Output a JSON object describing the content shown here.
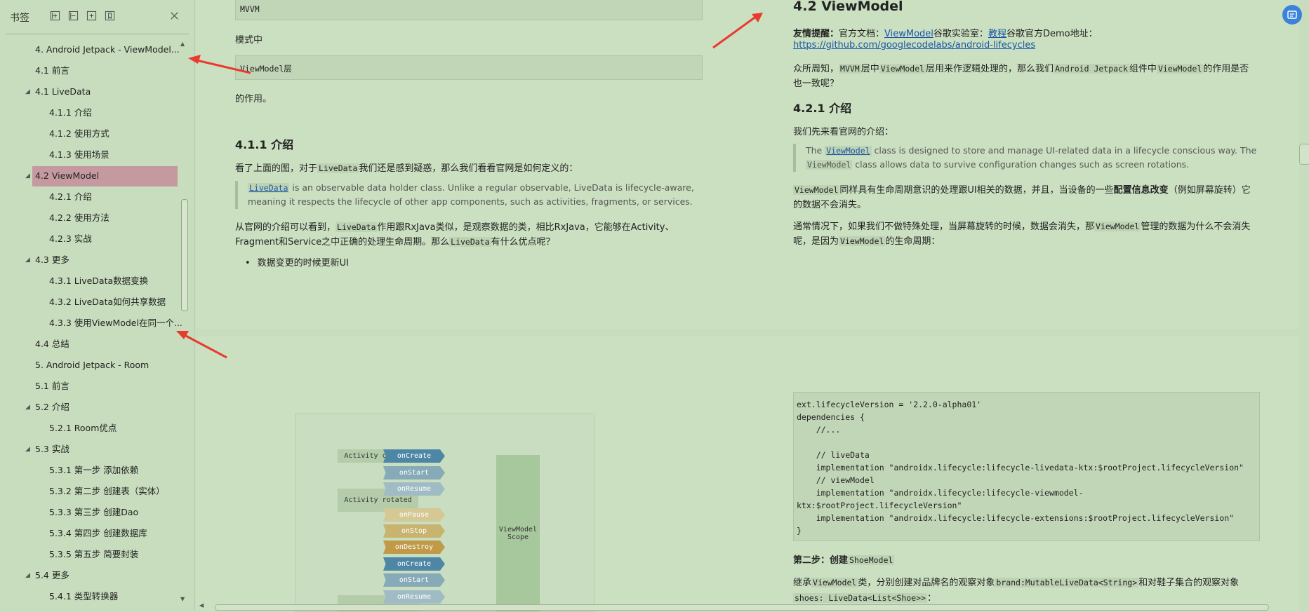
{
  "sidebar": {
    "title": "书签",
    "tools": [
      "expand-all-icon",
      "collapse-all-icon",
      "add-bookmark-icon",
      "bookmark-icon"
    ],
    "close_icon": "close-icon",
    "items": [
      {
        "label": "4. Android Jetpack - ViewModel...",
        "level": 0,
        "expand": false
      },
      {
        "label": "4.1 前言",
        "level": 0,
        "expand": false
      },
      {
        "label": "4.1 LiveData",
        "level": 0,
        "expand": true
      },
      {
        "label": "4.1.1 介绍",
        "level": 1,
        "expand": false
      },
      {
        "label": "4.1.2 使用方式",
        "level": 1,
        "expand": false
      },
      {
        "label": "4.1.3 使用场景",
        "level": 1,
        "expand": false
      },
      {
        "label": "4.2 ViewModel",
        "level": 0,
        "expand": true,
        "selected": true
      },
      {
        "label": "4.2.1 介绍",
        "level": 1,
        "expand": false
      },
      {
        "label": "4.2.2 使用方法",
        "level": 1,
        "expand": false
      },
      {
        "label": "4.2.3 实战",
        "level": 1,
        "expand": false
      },
      {
        "label": "4.3 更多",
        "level": 0,
        "expand": true
      },
      {
        "label": "4.3.1 LiveData数据变换",
        "level": 1,
        "expand": false
      },
      {
        "label": "4.3.2 LiveData如何共享数据",
        "level": 1,
        "expand": false
      },
      {
        "label": "4.3.3 使用ViewModel在同一个...",
        "level": 1,
        "expand": false
      },
      {
        "label": "4.4 总结",
        "level": 0,
        "expand": false
      },
      {
        "label": "5. Android Jetpack - Room",
        "level": 0,
        "expand": false
      },
      {
        "label": "5.1 前言",
        "level": 0,
        "expand": false
      },
      {
        "label": "5.2 介绍",
        "level": 0,
        "expand": true
      },
      {
        "label": "5.2.1 Room优点",
        "level": 1,
        "expand": false
      },
      {
        "label": "5.3 实战",
        "level": 0,
        "expand": true
      },
      {
        "label": "5.3.1 第一步 添加依赖",
        "level": 1,
        "expand": false
      },
      {
        "label": "5.3.2 第二步 创建表（实体）",
        "level": 1,
        "expand": false
      },
      {
        "label": "5.3.3 第三步 创建Dao",
        "level": 1,
        "expand": false
      },
      {
        "label": "5.3.4 第四步 创建数据库",
        "level": 1,
        "expand": false
      },
      {
        "label": "5.3.5 第五步 简要封装",
        "level": 1,
        "expand": false
      },
      {
        "label": "5.4 更多",
        "level": 0,
        "expand": true
      },
      {
        "label": "5.4.1 类型转换器",
        "level": 1,
        "expand": false
      }
    ]
  },
  "left_page": {
    "code_mvvm": "MVVM",
    "text_mode": "模式中",
    "code_vm_layer": "ViewModel层",
    "text_role": "的作用。",
    "heading_411": "4.1.1 介绍",
    "para_1a": "看了上面的图，对于",
    "para_1_code": "LiveData",
    "para_1b": "我们还是感到疑惑，那么我们看看官网是如何定义的：",
    "quote_link": "LiveData",
    "quote_line1": " is an observable data holder class. Unlike a regular observable, LiveData is lifecycle-aware,",
    "quote_line2": "meaning it respects the lifecycle of other app components, such as activities, fragments, or services.",
    "para_2a": "从官网的介绍可以看到，",
    "para_2_code": "LiveData",
    "para_2b": "作用跟RxJava类似，是观察数据的类，相比RxJava，它能够在Activity、",
    "para_2c": "Fragment和Service之中正确的处理生命周期。那么",
    "para_2_code2": "LiveData",
    "para_2d": "有什么优点呢？",
    "bullet_1": "数据变更的时候更新UI"
  },
  "right_page": {
    "heading_42": "4.2 ViewModel",
    "tip_label": "友情提醒：",
    "tip_a": "官方文档：",
    "tip_link1": "ViewModel",
    "tip_b": "谷歌实验室：",
    "tip_link2": "教程",
    "tip_c": "谷歌官方Demo地址：",
    "tip_url": "https://github.com/googlecodelabs/android-lifecycles",
    "para_1a": "众所周知，",
    "para_1_code1": "MVVM",
    "para_1b": "层中",
    "para_1_code2": "ViewModel",
    "para_1c": "层用来作逻辑处理的，那么我们",
    "para_1_code3": "Android Jetpack",
    "para_1d": "组件中",
    "para_1_code4": "ViewModel",
    "para_1e": "的作用是否",
    "para_1f": "也一致呢？",
    "heading_421": "4.2.1 介绍",
    "para_2": "我们先来看官网的介绍：",
    "quote_a": "The ",
    "quote_link": "ViewModel",
    "quote_b": " class is designed to store and manage UI-related data in a lifecycle conscious way. The",
    "quote_code": "ViewModel",
    "quote_c": " class allows data to survive configuration changes such as screen rotations.",
    "para_3_code": "ViewModel",
    "para_3a": "同样具有生命周期意识的处理跟UI相关的数据，并且，当设备的一些",
    "para_3_bold": "配置信息改变",
    "para_3b": "（例如屏幕旋转）它",
    "para_3c": "的数据不会消失。",
    "para_4a": "通常情况下，如果我们不做特殊处理，当屏幕旋转的时候，数据会消失，那",
    "para_4_code": "ViewModel",
    "para_4b": "管理的数据为什么不会消失",
    "para_4c": "呢，是因为",
    "para_4_code2": "ViewModel",
    "para_4d": "的生命周期：",
    "code_lines": [
      "ext.lifecycleVersion = '2.2.0-alpha01'",
      "dependencies {",
      "    //...",
      "",
      "    // liveData",
      "    implementation \"androidx.lifecycle:lifecycle-livedata-ktx:$rootProject.lifecycleVersion\"",
      "    // viewModel",
      "    implementation \"androidx.lifecycle:lifecycle-viewmodel-",
      "ktx:$rootProject.lifecycleVersion\"",
      "    implementation \"androidx.lifecycle:lifecycle-extensions:$rootProject.lifecycleVersion\"",
      "}"
    ],
    "step2_label": "第二步：创建",
    "step2_code": "ShoeModel",
    "para_5a": "继承",
    "para_5_code1": "ViewModel",
    "para_5b": "类，分别创建对品牌名的观察对象",
    "para_5_code2": "brand:MutableLiveData<String>",
    "para_5c": "和对鞋子集合的观察对象",
    "para_5_code3": "shoes: LiveData<List<Shoe>>",
    "para_5d": "："
  },
  "diagram": {
    "labels": [
      "Activity created",
      "Activity rotated"
    ],
    "events": [
      {
        "name": "onCreate",
        "color": "#4e87a6"
      },
      {
        "name": "onStart",
        "color": "#86aab8"
      },
      {
        "name": "onResume",
        "color": "#9fbcc4"
      },
      {
        "name": "onPause",
        "color": "#d4c895"
      },
      {
        "name": "onStop",
        "color": "#c8b46e"
      },
      {
        "name": "onDestroy",
        "color": "#c09a48"
      },
      {
        "name": "onCreate",
        "color": "#4e87a6"
      },
      {
        "name": "onStart",
        "color": "#86aab8"
      },
      {
        "name": "onResume",
        "color": "#9fbcc4"
      }
    ],
    "scope_label": "ViewModel\nScope"
  }
}
